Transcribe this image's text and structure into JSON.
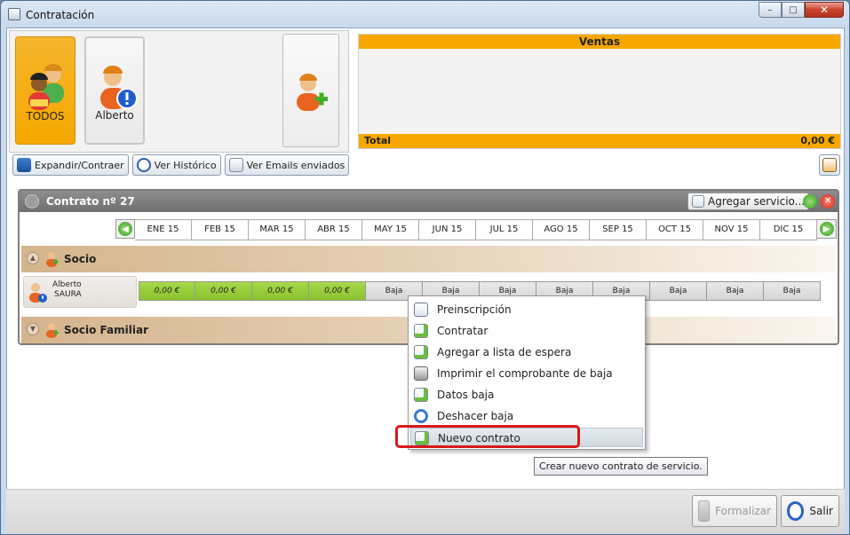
{
  "window": {
    "title": "Contratación",
    "min": "–",
    "max": "□",
    "close": "✕"
  },
  "profiles": [
    {
      "label": "TODOS"
    },
    {
      "label": "Alberto"
    }
  ],
  "ventas": {
    "title": "Ventas",
    "total_label": "Total",
    "total_value": "0,00 €"
  },
  "toolbar": {
    "expand": "Expandir/Contraer",
    "history": "Ver Histórico",
    "emails": "Ver Emails enviados"
  },
  "contract": {
    "title": "Contrato nº 27",
    "add_service": "Agregar servicio...",
    "months": [
      "ENE 15",
      "FEB 15",
      "MAR 15",
      "ABR 15",
      "MAY 15",
      "JUN 15",
      "JUL 15",
      "AGO 15",
      "SEP 15",
      "OCT 15",
      "NOV 15",
      "DIC 15"
    ],
    "sections": [
      {
        "title": "Socio"
      },
      {
        "title": "Socio Familiar"
      }
    ],
    "member": {
      "first": "Alberto",
      "last": "SAURA"
    },
    "cells": [
      "0,00 €",
      "0,00 €",
      "0,00 €",
      "0,00 €",
      "Baja",
      "Baja",
      "Baja",
      "Baja",
      "Baja",
      "Baja",
      "Baja",
      "Baja"
    ]
  },
  "menu": {
    "items": [
      "Preinscripción",
      "Contratar",
      "Agregar a lista de espera",
      "Imprimir el comprobante de baja",
      "Datos baja",
      "Deshacer baja",
      "Nuevo contrato"
    ],
    "icons": [
      "clipboard-check-icon",
      "pencil-note-icon",
      "pencil-note-icon",
      "printer-icon",
      "pencil-note-icon",
      "undo-icon",
      "pencil-note-icon"
    ],
    "highlighted": 6
  },
  "tooltip": "Crear nuevo contrato de servicio.",
  "bottom": {
    "formalizar": "Formalizar",
    "salir": "Salir"
  },
  "colors": {
    "accent": "#f7a800",
    "paid": "#9ccf3c",
    "highlight_box": "#d81818"
  }
}
